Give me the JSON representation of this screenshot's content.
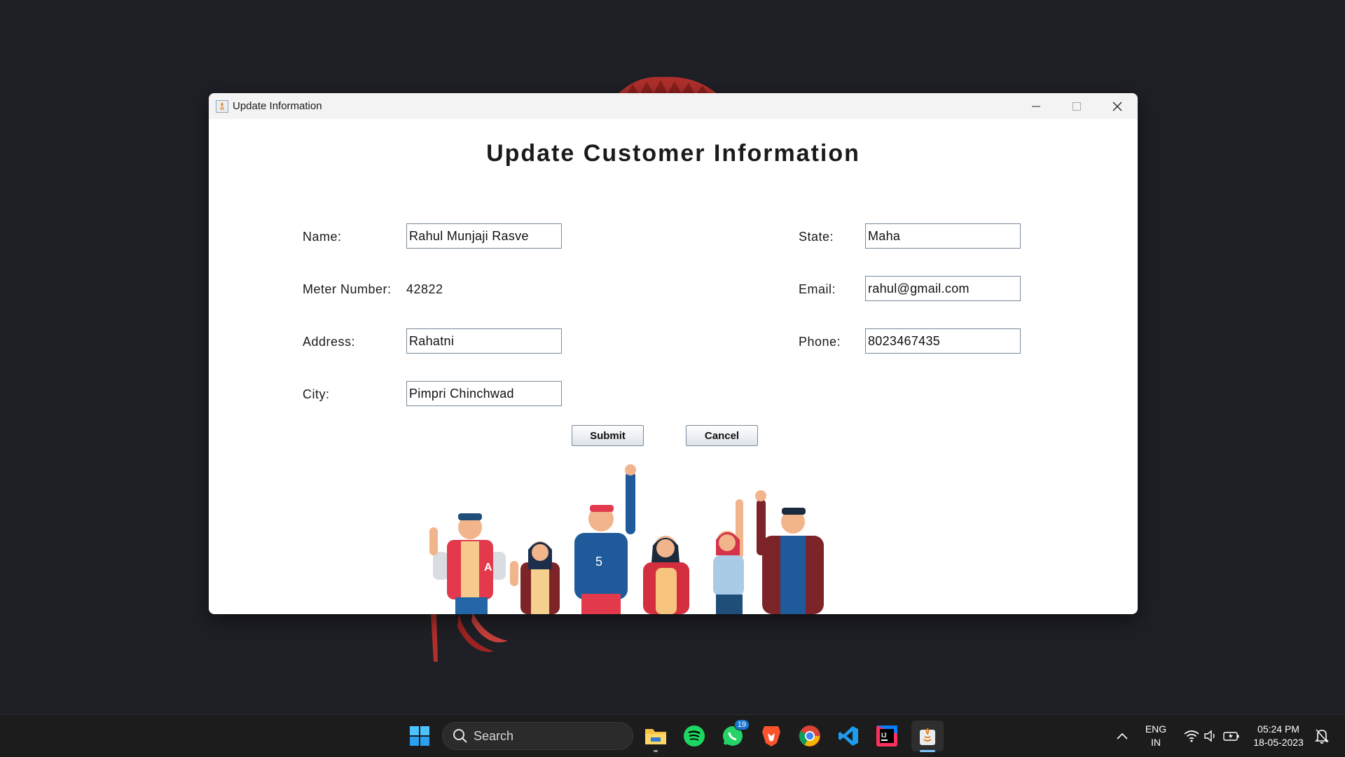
{
  "window": {
    "title": "Update Information"
  },
  "form": {
    "heading": "Update Customer Information",
    "name_label": "Name:",
    "name_value": "Rahul Munjaji Rasve",
    "meter_label": "Meter Number:",
    "meter_value": "42822",
    "address_label": "Address:",
    "address_value": "Rahatni",
    "city_label": "City:",
    "city_value": "Pimpri Chinchwad",
    "state_label": "State:",
    "state_value": "Maha",
    "email_label": "Email:",
    "email_value": "rahul@gmail.com",
    "phone_label": "Phone:",
    "phone_value": "8023467435",
    "submit_label": "Submit",
    "cancel_label": "Cancel"
  },
  "taskbar": {
    "search_label": "Search",
    "whatsapp_badge": "19",
    "lang_primary": "ENG",
    "lang_secondary": "IN",
    "time": "05:24 PM",
    "date": "18-05-2023",
    "pinned_apps": [
      "file-explorer",
      "spotify",
      "whatsapp",
      "brave",
      "chrome",
      "vscode",
      "intellij",
      "java"
    ]
  },
  "colors": {
    "desktop_bg": "#1f2026",
    "window_bg": "#ffffff",
    "titlebar_bg": "#f3f3f3",
    "taskbar_bg": "#1c1c1c",
    "accent": "#7cc4ff"
  }
}
